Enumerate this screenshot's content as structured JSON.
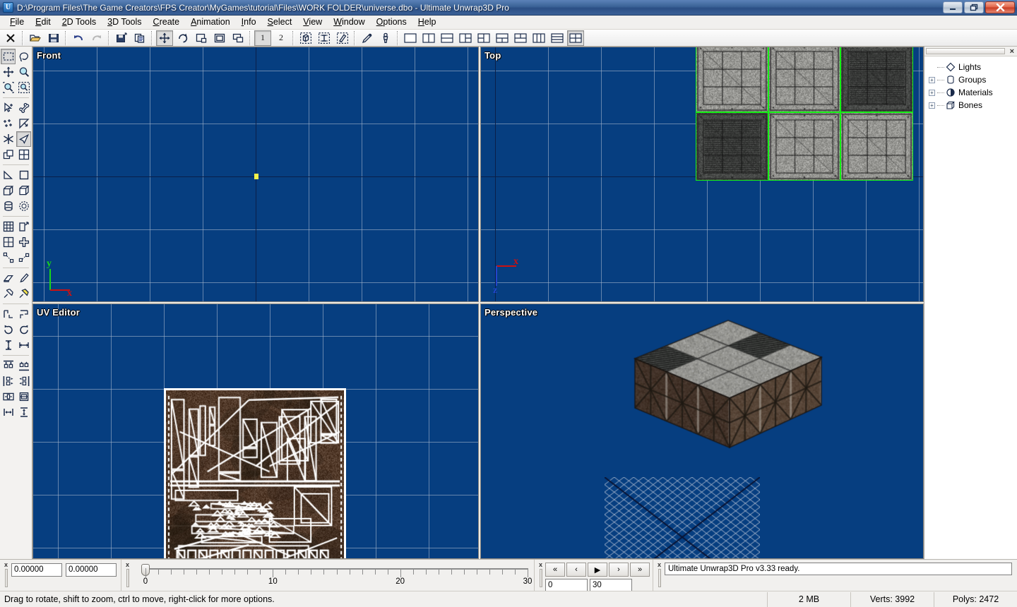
{
  "window": {
    "title": "D:\\Program Files\\The Game Creators\\FPS Creator\\MyGames\\tutorial\\Files\\WORK FOLDER\\universe.dbo - Ultimate Unwrap3D Pro",
    "icon": "U",
    "minimize_label": "minimize-icon",
    "restore_label": "restore-icon",
    "close_label": "close-icon"
  },
  "menu": {
    "items": [
      {
        "label": "File"
      },
      {
        "label": "Edit"
      },
      {
        "label": "2D Tools"
      },
      {
        "label": "3D Tools"
      },
      {
        "label": "Create"
      },
      {
        "label": "Animation"
      },
      {
        "label": "Info"
      },
      {
        "label": "Select"
      },
      {
        "label": "View"
      },
      {
        "label": "Window"
      },
      {
        "label": "Options"
      },
      {
        "label": "Help"
      }
    ]
  },
  "toolbar": {
    "groups": [
      {
        "buttons": [
          {
            "name": "close-file-icon",
            "pressed": false
          }
        ]
      },
      {
        "buttons": [
          {
            "name": "open-icon",
            "pressed": false
          },
          {
            "name": "save-icon",
            "pressed": false
          }
        ]
      },
      {
        "buttons": [
          {
            "name": "undo-icon",
            "pressed": false
          },
          {
            "name": "redo-icon",
            "pressed": false
          }
        ]
      },
      {
        "buttons": [
          {
            "name": "save-selection-icon",
            "pressed": false
          },
          {
            "name": "copy-icon",
            "pressed": false
          }
        ]
      },
      {
        "buttons": [
          {
            "name": "move-icon",
            "pressed": true
          },
          {
            "name": "rotate-icon",
            "pressed": false
          },
          {
            "name": "scale-icon",
            "pressed": false
          },
          {
            "name": "fit-icon",
            "pressed": false
          },
          {
            "name": "offset-icon",
            "pressed": false
          }
        ]
      },
      {
        "buttons": [
          {
            "name": "layer-1-button",
            "label": "1",
            "pressed": true
          },
          {
            "name": "layer-2-button",
            "label": "2",
            "pressed": false
          }
        ]
      },
      {
        "buttons": [
          {
            "name": "select-object-icon",
            "pressed": false
          },
          {
            "name": "select-face-icon",
            "pressed": false
          },
          {
            "name": "select-uv-icon",
            "pressed": false
          }
        ]
      },
      {
        "buttons": [
          {
            "name": "eyedropper-icon",
            "pressed": false
          },
          {
            "name": "paint-icon",
            "pressed": false
          }
        ]
      }
    ],
    "layouts": [
      {
        "name": "layout-single",
        "active": false
      },
      {
        "name": "layout-two-vertical",
        "active": false
      },
      {
        "name": "layout-two-horizontal",
        "active": false
      },
      {
        "name": "layout-one-left-two-right",
        "active": false
      },
      {
        "name": "layout-two-left-one-right",
        "active": false
      },
      {
        "name": "layout-one-top-two-bottom",
        "active": false
      },
      {
        "name": "layout-two-top-one-bottom",
        "active": false
      },
      {
        "name": "layout-three-vertical",
        "active": false
      },
      {
        "name": "layout-three-horizontal",
        "active": false
      },
      {
        "name": "layout-quad",
        "active": true
      }
    ]
  },
  "palette": {
    "rows": [
      {
        "tools": [
          {
            "name": "rect-select-tool",
            "pressed": true
          },
          {
            "name": "lasso-select-tool",
            "pressed": false
          }
        ]
      },
      {
        "tools": [
          {
            "name": "pan-tool",
            "pressed": false
          },
          {
            "name": "zoom-tool",
            "pressed": false
          }
        ]
      },
      {
        "tools": [
          {
            "name": "zoom-in-tool",
            "pressed": false
          },
          {
            "name": "zoom-region-tool",
            "pressed": false
          }
        ]
      },
      {
        "sep": true
      },
      {
        "tools": [
          {
            "name": "select-point-tool",
            "pressed": false
          },
          {
            "name": "bone-tool",
            "pressed": false
          }
        ]
      },
      {
        "tools": [
          {
            "name": "add-points-tool",
            "pressed": false
          },
          {
            "name": "select-arrow-tool",
            "pressed": false
          }
        ]
      },
      {
        "tools": [
          {
            "name": "snap-tool",
            "pressed": false
          },
          {
            "name": "face-select-tool",
            "pressed": true
          }
        ]
      },
      {
        "tools": [
          {
            "name": "duplicate-tool",
            "pressed": false
          },
          {
            "name": "grid-tool",
            "pressed": false
          }
        ]
      },
      {
        "sep": true
      },
      {
        "tools": [
          {
            "name": "triangle-primitive-tool",
            "pressed": false
          },
          {
            "name": "plane-primitive-tool",
            "pressed": false
          }
        ]
      },
      {
        "tools": [
          {
            "name": "box-primitive-tool",
            "pressed": false
          },
          {
            "name": "cube-primitive-tool",
            "pressed": false
          }
        ]
      },
      {
        "tools": [
          {
            "name": "cylinder-primitive-tool",
            "pressed": false
          },
          {
            "name": "sphere-primitive-tool",
            "pressed": false
          }
        ]
      },
      {
        "sep": true
      },
      {
        "tools": [
          {
            "name": "subdivide-tool",
            "pressed": false
          },
          {
            "name": "extrude-tool",
            "pressed": false
          }
        ]
      },
      {
        "tools": [
          {
            "name": "weld-tool",
            "pressed": false
          },
          {
            "name": "move-axis-tool",
            "pressed": false
          }
        ]
      },
      {
        "tools": [
          {
            "name": "split-edge-tool",
            "pressed": false
          },
          {
            "name": "connect-tool",
            "pressed": false
          }
        ]
      },
      {
        "sep": true
      },
      {
        "tools": [
          {
            "name": "eraser-tool",
            "pressed": false
          },
          {
            "name": "pencil-tool",
            "pressed": false
          }
        ]
      },
      {
        "tools": [
          {
            "name": "pin-tool",
            "pressed": false
          },
          {
            "name": "pin-active-tool",
            "pressed": false
          }
        ]
      },
      {
        "sep": true
      },
      {
        "tools": [
          {
            "name": "flip-horizontal-tool",
            "pressed": false
          },
          {
            "name": "flip-vertical-tool",
            "pressed": false
          }
        ]
      },
      {
        "tools": [
          {
            "name": "rotate-cw-tool",
            "pressed": false
          },
          {
            "name": "rotate-ccw-tool",
            "pressed": false
          }
        ]
      },
      {
        "tools": [
          {
            "name": "scale-vertical-tool",
            "pressed": false
          },
          {
            "name": "scale-horizontal-tool",
            "pressed": false
          }
        ]
      },
      {
        "sep": true
      },
      {
        "tools": [
          {
            "name": "align-top-tool",
            "pressed": false
          },
          {
            "name": "align-bottom-tool",
            "pressed": false
          }
        ]
      },
      {
        "tools": [
          {
            "name": "align-left-tool",
            "pressed": false
          },
          {
            "name": "align-right-tool",
            "pressed": false
          }
        ]
      },
      {
        "tools": [
          {
            "name": "center-horizontal-tool",
            "pressed": false
          },
          {
            "name": "center-vertical-tool",
            "pressed": false
          }
        ]
      },
      {
        "tools": [
          {
            "name": "distribute-horizontal-tool",
            "pressed": false
          },
          {
            "name": "distribute-vertical-tool",
            "pressed": false
          }
        ]
      }
    ]
  },
  "viewports": {
    "front": {
      "label": "Front",
      "axes": [
        {
          "label": "y",
          "color": "#19d619"
        },
        {
          "label": "x",
          "color": "#cc1111"
        }
      ]
    },
    "top": {
      "label": "Top",
      "axes": [
        {
          "label": "x",
          "color": "#cc1111"
        },
        {
          "label": "z",
          "color": "#2246cc"
        }
      ]
    },
    "uv_editor": {
      "label": "UV Editor"
    },
    "perspective": {
      "label": "Perspective"
    },
    "background_color": "#063E80",
    "grid_color": "#A0B2C8",
    "selection_color": "#14F014"
  },
  "tree": {
    "close_label": "×",
    "nodes": [
      {
        "label": "Lights",
        "icon": "diamond-icon",
        "expandable": false
      },
      {
        "label": "Groups",
        "icon": "cylinder-icon",
        "expandable": true,
        "expand_glyph": "+"
      },
      {
        "label": "Materials",
        "icon": "sphere-icon",
        "expandable": true,
        "expand_glyph": "+"
      },
      {
        "label": "Bones",
        "icon": "box-icon",
        "expandable": true,
        "expand_glyph": "+"
      }
    ]
  },
  "dock": {
    "coords": {
      "close_label": "x",
      "x_value": "0.00000",
      "y_value": "0.00000"
    },
    "timeline": {
      "close_label": "x",
      "ticks": [
        0,
        1,
        2,
        3,
        4,
        5,
        6,
        7,
        8,
        9,
        10,
        11,
        12,
        13,
        14,
        15,
        16,
        17,
        18,
        19,
        20,
        21,
        22,
        23,
        24,
        25,
        26,
        27,
        28,
        29,
        30
      ],
      "major_labels": [
        "0",
        "10",
        "20",
        "30"
      ],
      "current_frame": 0,
      "range_min": 0,
      "range_max": 30
    },
    "playback": {
      "close_label": "x",
      "buttons": [
        {
          "name": "first-frame-button",
          "label": "«"
        },
        {
          "name": "prev-frame-button",
          "label": "‹"
        },
        {
          "name": "play-button",
          "label": "▶"
        },
        {
          "name": "next-frame-button",
          "label": "›"
        },
        {
          "name": "last-frame-button",
          "label": "»"
        }
      ],
      "start_frame": "0",
      "end_frame": "30"
    },
    "log": {
      "close_label": "x",
      "message": "Ultimate Unwrap3D Pro v3.33 ready."
    }
  },
  "status": {
    "message": "Drag to rotate, shift to zoom, ctrl to move, right-click for more options.",
    "memory": "2 MB",
    "verts": "Verts: 3992",
    "polys": "Polys: 2472"
  }
}
